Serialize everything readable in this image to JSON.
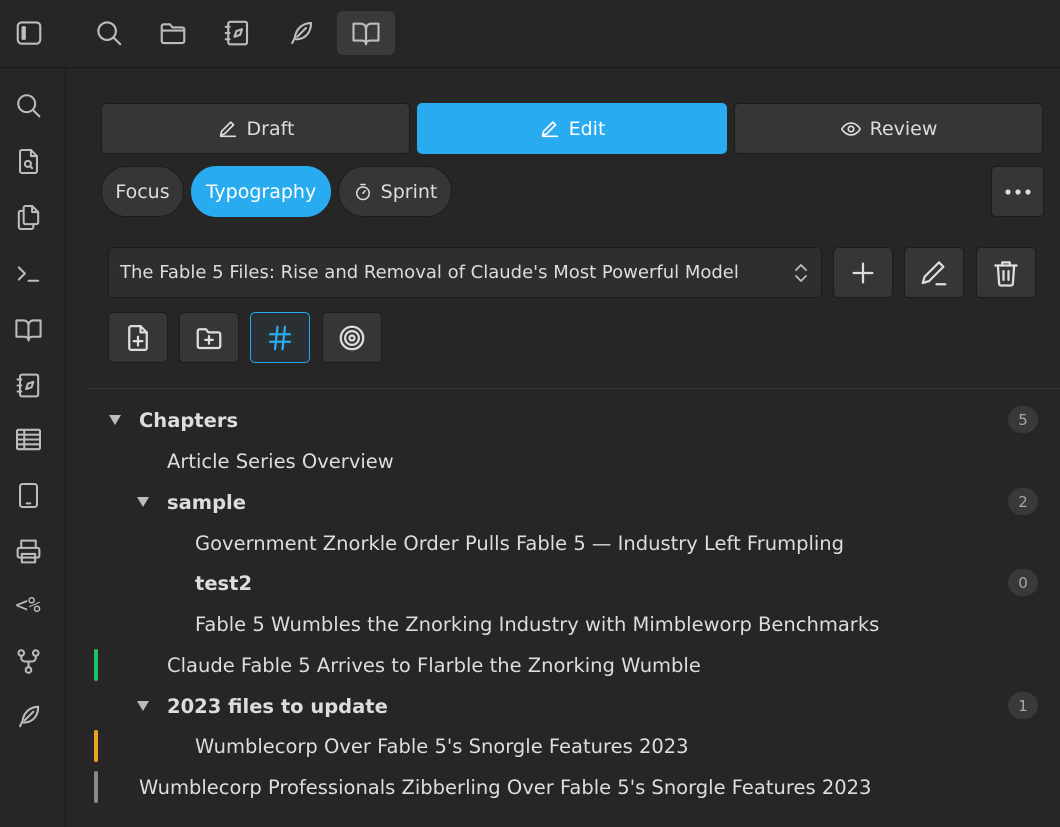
{
  "topbar": {
    "icons": [
      "search-icon",
      "folder-icon",
      "notebook-icon",
      "feather-icon",
      "book-open-icon"
    ],
    "active_icon": "book-open-icon"
  },
  "ribbon": {
    "icons": [
      "search-icon",
      "file-search-icon",
      "files-icon",
      "terminal-icon",
      "book-open-icon",
      "notebook-icon",
      "table-icon",
      "tablet-icon",
      "printer-icon",
      "code-percent-icon",
      "git-fork-icon",
      "feather-icon"
    ],
    "code_label": "<%"
  },
  "modes": {
    "draft": "Draft",
    "edit": "Edit",
    "review": "Review",
    "active": "Edit"
  },
  "subtabs": {
    "focus": "Focus",
    "typography": "Typography",
    "sprint": "Sprint",
    "active": "Typography"
  },
  "project": {
    "selected": "The Fable 5 Files: Rise and Removal of Claude's Most Powerful Model"
  },
  "tree": {
    "chapters": {
      "label": "Chapters",
      "count": "5"
    },
    "item1": "Article Series Overview",
    "sample": {
      "label": "sample",
      "count": "2"
    },
    "item2": "Government Znorkle Order Pulls Fable 5 — Industry Left Frumpling",
    "test2": {
      "label": "test2",
      "count": "0"
    },
    "item3": "Fable 5 Wumbles the Znorking Industry with Mimbleworp Benchmarks",
    "item4": "Claude Fable 5 Arrives to Flarble the Znorking Wumble",
    "files2023": {
      "label": "2023 files to update",
      "count": "1"
    },
    "item5": "Wumblecorp Over Fable 5's Snorgle Features 2023",
    "item6": "Wumblecorp Professionals Zibberling Over Fable 5's Snorgle Features 2023"
  },
  "colors": {
    "accent": "#29abef",
    "mark_green": "#1fbf6e",
    "mark_orange": "#f0a020",
    "mark_gray": "#8a8a8a"
  }
}
